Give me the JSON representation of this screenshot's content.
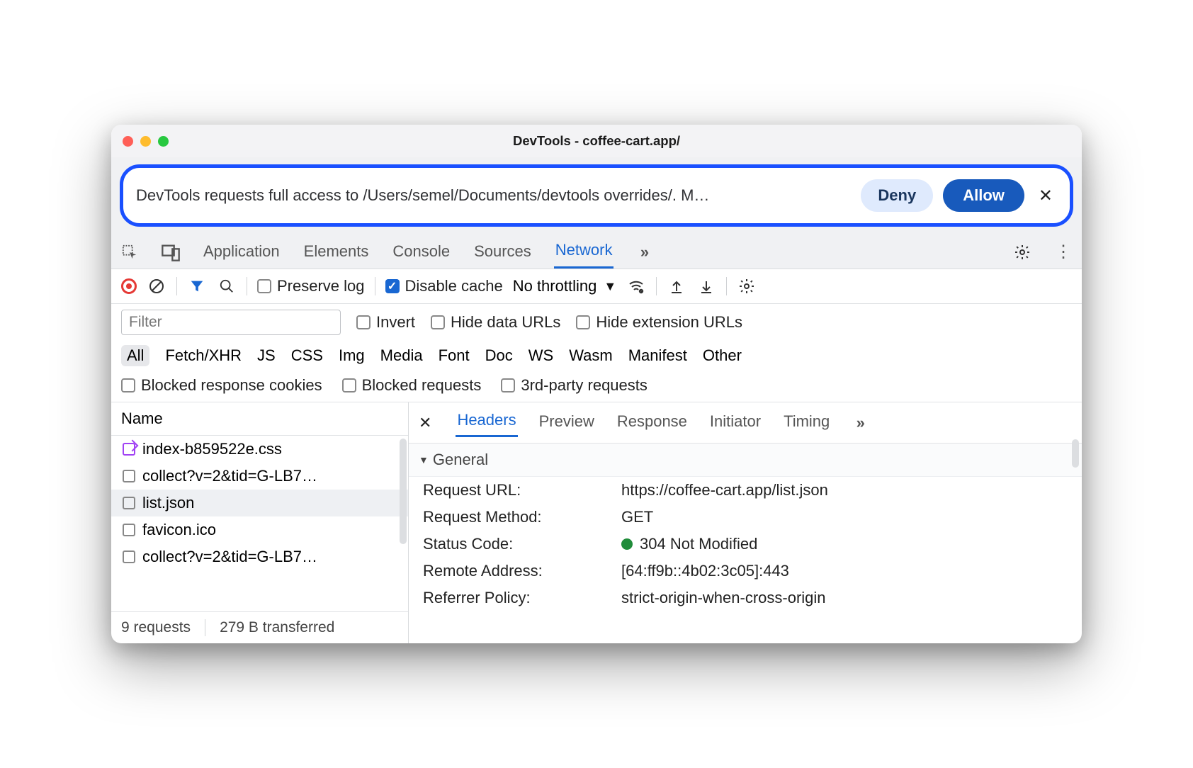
{
  "window_title": "DevTools - coffee-cart.app/",
  "banner": {
    "message": "DevTools requests full access to /Users/semel/Documents/devtools overrides/. M…",
    "deny": "Deny",
    "allow": "Allow"
  },
  "panel_tabs": {
    "application": "Application",
    "elements": "Elements",
    "console": "Console",
    "sources": "Sources",
    "network": "Network"
  },
  "toolbar": {
    "preserve_log": "Preserve log",
    "disable_cache": "Disable cache",
    "throttling": "No throttling"
  },
  "filter": {
    "placeholder": "Filter",
    "invert": "Invert",
    "hide_data_urls": "Hide data URLs",
    "hide_ext_urls": "Hide extension URLs"
  },
  "type_chips": {
    "all": "All",
    "fetch": "Fetch/XHR",
    "js": "JS",
    "css": "CSS",
    "img": "Img",
    "media": "Media",
    "font": "Font",
    "doc": "Doc",
    "ws": "WS",
    "wasm": "Wasm",
    "manifest": "Manifest",
    "other": "Other"
  },
  "bottom_filters": {
    "blocked_cookies": "Blocked response cookies",
    "blocked_requests": "Blocked requests",
    "third_party": "3rd-party requests"
  },
  "list": {
    "header": "Name",
    "items": [
      "index-b859522e.css",
      "collect?v=2&tid=G-LB7…",
      "list.json",
      "favicon.ico",
      "collect?v=2&tid=G-LB7…"
    ],
    "footer_requests": "9 requests",
    "footer_transferred": "279 B transferred"
  },
  "detail_tabs": {
    "headers": "Headers",
    "preview": "Preview",
    "response": "Response",
    "initiator": "Initiator",
    "timing": "Timing"
  },
  "general": {
    "title": "General",
    "request_url_k": "Request URL:",
    "request_url_v": "https://coffee-cart.app/list.json",
    "method_k": "Request Method:",
    "method_v": "GET",
    "status_k": "Status Code:",
    "status_v": "304 Not Modified",
    "remote_k": "Remote Address:",
    "remote_v": "[64:ff9b::4b02:3c05]:443",
    "referrer_k": "Referrer Policy:",
    "referrer_v": "strict-origin-when-cross-origin"
  }
}
